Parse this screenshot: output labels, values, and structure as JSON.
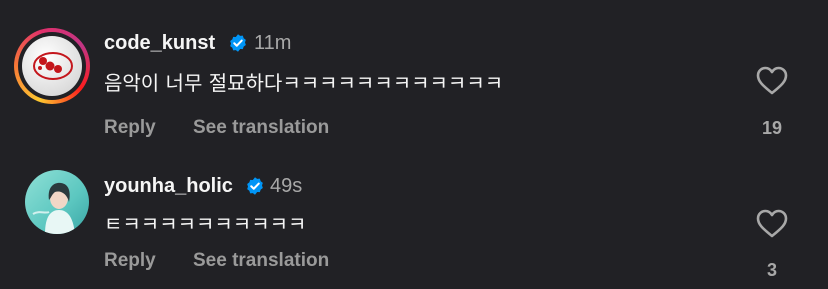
{
  "comments": [
    {
      "username": "code_kunst",
      "time": "11m",
      "text": "음악이 너무 절묘하다ㅋㅋㅋㅋㅋㅋㅋㅋㅋㅋㅋㅋ",
      "reply_label": "Reply",
      "translate_label": "See translation",
      "likes": "19",
      "has_story": true,
      "avatar_icon": "code-kunst-logo"
    },
    {
      "username": "younha_holic",
      "time": "49s",
      "text": "ㅌㅋㅋㅋㅋㅋㅋㅋㅋㅋㅋ",
      "reply_label": "Reply",
      "translate_label": "See translation",
      "likes": "3",
      "has_story": false,
      "avatar_icon": "profile-photo"
    }
  ],
  "colors": {
    "background": "#212125",
    "primary_text": "#f5f5f5",
    "secondary_text": "#a8a8a8",
    "verified_blue": "#0095f6"
  },
  "icons": {
    "verified": "verified-badge-icon",
    "like": "heart-outline-icon"
  }
}
